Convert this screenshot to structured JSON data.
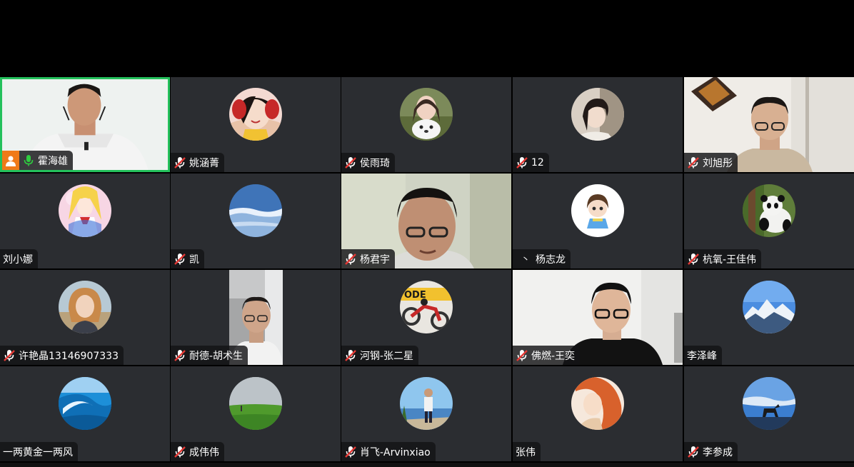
{
  "participants": [
    {
      "name": "霍海雄",
      "mic": "on",
      "host": true,
      "kind": "video",
      "scene": "man-white"
    },
    {
      "name": "姚涵菁",
      "mic": "muted",
      "kind": "avatar",
      "avatar": "girl-red"
    },
    {
      "name": "侯雨琦",
      "mic": "muted",
      "kind": "avatar",
      "avatar": "girl-dog"
    },
    {
      "name": "12",
      "mic": "muted",
      "kind": "avatar",
      "avatar": "girl-lying"
    },
    {
      "name": "刘旭彤",
      "mic": "muted",
      "kind": "video",
      "scene": "man-glasses-office"
    },
    {
      "name": "刘小娜",
      "mic": "none",
      "kind": "avatar",
      "avatar": "anime-pink"
    },
    {
      "name": "凯",
      "mic": "muted",
      "kind": "avatar",
      "avatar": "sky-blue"
    },
    {
      "name": "杨君宇",
      "mic": "muted",
      "kind": "video",
      "scene": "man-closeup"
    },
    {
      "name": "杨志龙",
      "mic": "dot",
      "kind": "avatar",
      "avatar": "cartoon-boy"
    },
    {
      "name": "杭氧-王佳伟",
      "mic": "muted",
      "kind": "avatar",
      "avatar": "panda"
    },
    {
      "name": "许艳晶13146907333",
      "mic": "muted",
      "kind": "avatar",
      "avatar": "woman-outdoor"
    },
    {
      "name": "耐德-胡术生",
      "mic": "muted",
      "kind": "video-narrow",
      "scene": "older-man"
    },
    {
      "name": "河钢-张二星",
      "mic": "muted",
      "kind": "avatar",
      "avatar": "motorbike"
    },
    {
      "name": "佛燃-王奕",
      "mic": "muted",
      "kind": "video",
      "scene": "man-black-glasses"
    },
    {
      "name": "李泽峰",
      "mic": "none",
      "kind": "avatar",
      "avatar": "snow-mountain"
    },
    {
      "name": "一两黄金一两风",
      "mic": "none",
      "kind": "avatar",
      "avatar": "ocean-wave"
    },
    {
      "name": "成伟伟",
      "mic": "muted",
      "kind": "avatar",
      "avatar": "grass-field"
    },
    {
      "name": "肖飞-Arvinxiao",
      "mic": "muted",
      "kind": "avatar",
      "avatar": "man-sea"
    },
    {
      "name": "张伟",
      "mic": "none",
      "kind": "avatar",
      "avatar": "woman-orange"
    },
    {
      "name": "李参成",
      "mic": "muted",
      "kind": "avatar",
      "avatar": "horse-sky"
    }
  ],
  "colors": {
    "tile": "#2b2d31",
    "active_border": "#24c15c",
    "mic_on": "#2ecc40",
    "mic_muted": "#e53935",
    "host_badge": "#f07a18"
  }
}
